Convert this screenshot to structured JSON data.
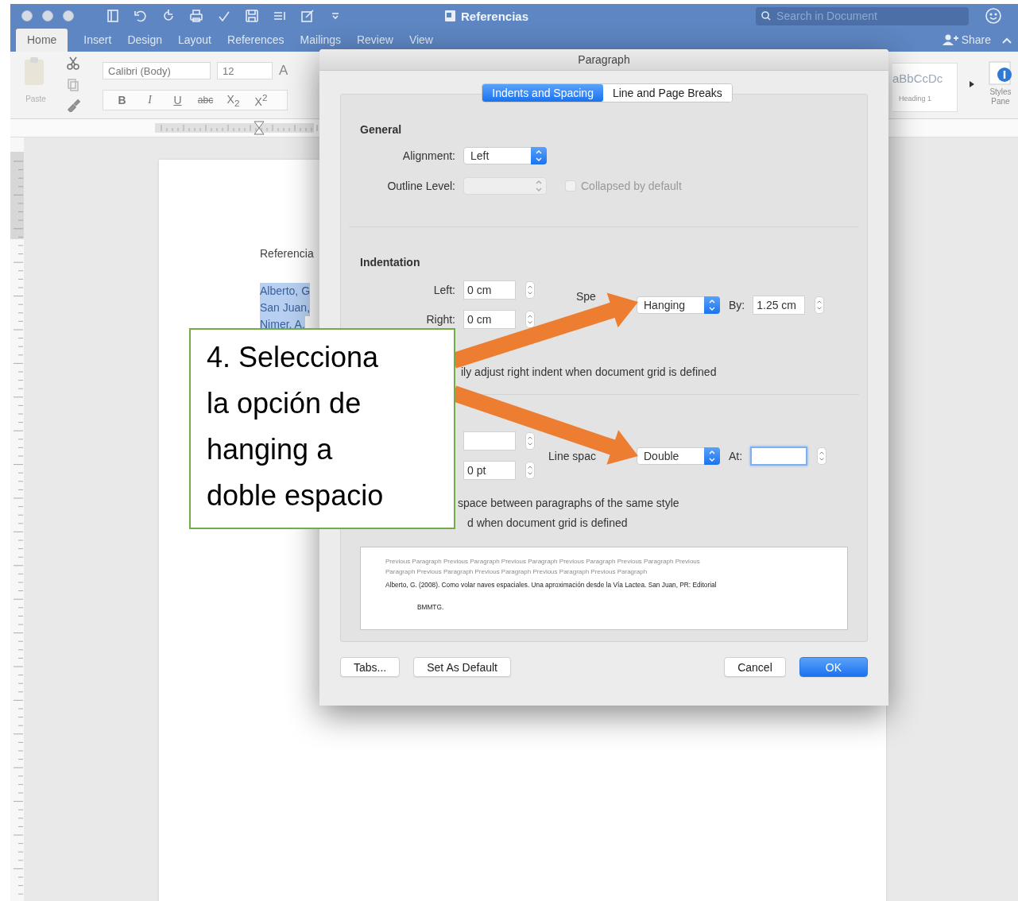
{
  "window": {
    "title": "Referencias"
  },
  "search": {
    "placeholder": "Search in Document"
  },
  "ribbon_tabs": [
    {
      "label": "Home",
      "selected": true
    },
    {
      "label": "Insert",
      "selected": false
    },
    {
      "label": "Design",
      "selected": false
    },
    {
      "label": "Layout",
      "selected": false
    },
    {
      "label": "References",
      "selected": false
    },
    {
      "label": "Mailings",
      "selected": false
    },
    {
      "label": "Review",
      "selected": false
    },
    {
      "label": "View",
      "selected": false
    }
  ],
  "share": {
    "label": "Share"
  },
  "ribbon": {
    "paste": "Paste",
    "font": "Calibri (Body)",
    "size": "12",
    "grow": "A",
    "format_buttons": [
      {
        "label": "B",
        "kind": "bold"
      },
      {
        "label": "I",
        "kind": "italic"
      },
      {
        "label": "U",
        "kind": "underline"
      },
      {
        "label": "abc",
        "kind": "strike"
      },
      {
        "label": "X$_{2}$",
        "kind": "plain"
      },
      {
        "label": "X$^{2}$",
        "kind": "plain"
      }
    ],
    "style_preview": "aBbCcDc",
    "style_name": "Heading 1",
    "styles_pane": "Styles Pane"
  },
  "document": {
    "heading": "Referencia",
    "lines": [
      {
        "text": "Alberto, G",
        "selected": true
      },
      {
        "text": "San Juan,",
        "selected": true
      },
      {
        "text": "Nimer, A.",
        "selected": true
      }
    ]
  },
  "dialog": {
    "title": "Paragraph",
    "tabs": [
      {
        "label": "Indents and Spacing",
        "selected": true
      },
      {
        "label": "Line and Page Breaks",
        "selected": false
      }
    ],
    "general": {
      "heading": "General",
      "alignment": {
        "label": "Alignment:",
        "value": "Left",
        "disabled": false
      },
      "outline_level": {
        "label": "Outline Level:",
        "disabled": true
      },
      "collapsed": {
        "label": "Collapsed by default",
        "checked": false,
        "disabled": true
      }
    },
    "indentation": {
      "heading": "Indentation",
      "left": {
        "label": "Left:",
        "value": "0 cm"
      },
      "right": {
        "label": "Right:",
        "value": "0 cm"
      },
      "special": {
        "label": "Spe",
        "value": "Hanging"
      },
      "by": {
        "label": "By:",
        "value": "1.25 cm"
      },
      "note": "ily adjust right indent when document grid is defined"
    },
    "spacing": {
      "after": {
        "value": "0 pt"
      },
      "line_spacing": {
        "label": "Line spac",
        "value": "Double"
      },
      "at": {
        "label": "At:",
        "focused": true
      },
      "notes": [
        "space between paragraphs of the same style",
        "d when document grid is defined"
      ]
    },
    "preview": {
      "previous": [
        "Previous Paragraph Previous Paragraph Previous Paragraph Previous Paragraph Previous Paragraph Previous",
        "Paragraph Previous Paragraph Previous Paragraph Previous Paragraph Previous Paragraph"
      ],
      "paragraph": "Alberto, G. (2008). Como volar naves espaciales. Una aproximación desde la Vía Lactea. San Juan, PR: Editorial",
      "continuation": "BMMTG."
    },
    "buttons": [
      {
        "label": "Tabs...",
        "kind": "normal"
      },
      {
        "label": "Set As Default",
        "kind": "normal"
      },
      {
        "label": "Cancel",
        "kind": "normal"
      },
      {
        "label": "OK",
        "kind": "default"
      }
    ]
  },
  "callout": {
    "text": "4. Selecciona la opción de hanging a doble espacio"
  }
}
